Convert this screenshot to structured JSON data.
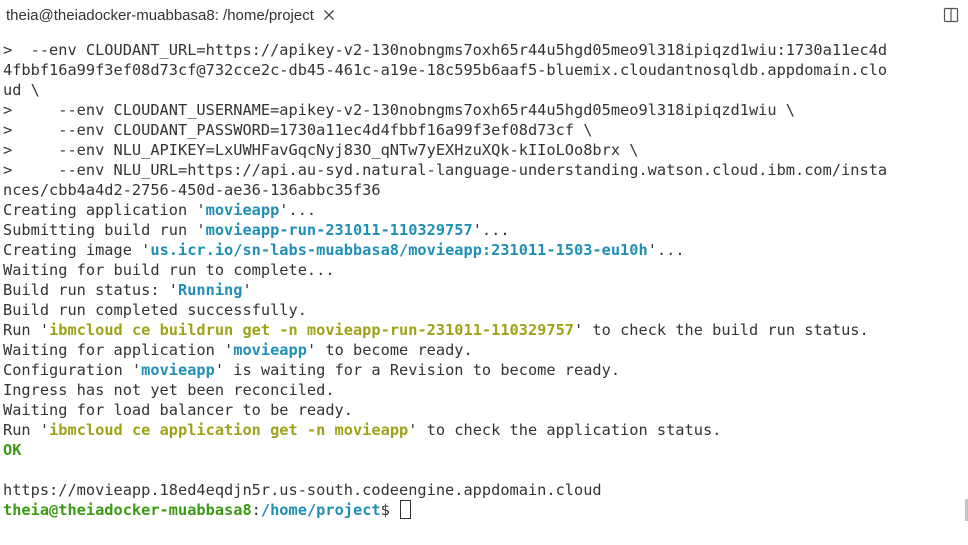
{
  "tab": {
    "title": "theia@theiadocker-muabbasa8: /home/project",
    "close_icon": "close-icon"
  },
  "toolbar": {
    "split_icon": "split-editor-icon"
  },
  "terminal": {
    "lines": [
      [
        {
          "t": ">  --env CLOUDANT_URL=https://apikey-v2-130nobngms7oxh65r44u5hgd05meo9l318ipiqzd1wiu:1730a11ec4d"
        }
      ],
      [
        {
          "t": "4fbbf16a99f3ef08d73cf@732cce2c-db45-461c-a19e-18c595b6aaf5-bluemix.cloudantnosqldb.appdomain.clo"
        }
      ],
      [
        {
          "t": "ud \\"
        }
      ],
      [
        {
          "t": ">     --env CLOUDANT_USERNAME=apikey-v2-130nobngms7oxh65r44u5hgd05meo9l318ipiqzd1wiu \\"
        }
      ],
      [
        {
          "t": ">     --env CLOUDANT_PASSWORD=1730a11ec4d4fbbf16a99f3ef08d73cf \\"
        }
      ],
      [
        {
          "t": ">     --env NLU_APIKEY=LxUWHFavGqcNyj83O_qNTw7yEXHzuXQk-kIIoLOo8brx \\"
        }
      ],
      [
        {
          "t": ">     --env NLU_URL=https://api.au-syd.natural-language-understanding.watson.cloud.ibm.com/insta"
        }
      ],
      [
        {
          "t": "nces/cbb4a4d2-2756-450d-ae36-136abbc35f36"
        }
      ],
      [
        {
          "t": "Creating application '"
        },
        {
          "t": "movieapp",
          "c": "cyan"
        },
        {
          "t": "'..."
        }
      ],
      [
        {
          "t": "Submitting build run '"
        },
        {
          "t": "movieapp-run-231011-110329757",
          "c": "cyan"
        },
        {
          "t": "'..."
        }
      ],
      [
        {
          "t": "Creating image '"
        },
        {
          "t": "us.icr.io/sn-labs-muabbasa8/movieapp:231011-1503-eu10h",
          "c": "cyan"
        },
        {
          "t": "'..."
        }
      ],
      [
        {
          "t": "Waiting for build run to complete..."
        }
      ],
      [
        {
          "t": "Build run status: '"
        },
        {
          "t": "Running",
          "c": "cyan"
        },
        {
          "t": "'"
        }
      ],
      [
        {
          "t": "Build run completed successfully."
        }
      ],
      [
        {
          "t": "Run '"
        },
        {
          "t": "ibmcloud ce buildrun get -n movieapp-run-231011-110329757",
          "c": "yellow"
        },
        {
          "t": "' to check the build run status."
        }
      ],
      [
        {
          "t": "Waiting for application '"
        },
        {
          "t": "movieapp",
          "c": "cyan"
        },
        {
          "t": "' to become ready."
        }
      ],
      [
        {
          "t": "Configuration '"
        },
        {
          "t": "movieapp",
          "c": "cyan"
        },
        {
          "t": "' is waiting for a Revision to become ready."
        }
      ],
      [
        {
          "t": "Ingress has not yet been reconciled."
        }
      ],
      [
        {
          "t": "Waiting for load balancer to be ready."
        }
      ],
      [
        {
          "t": "Run '"
        },
        {
          "t": "ibmcloud ce application get -n movieapp",
          "c": "yellow"
        },
        {
          "t": "' to check the application status."
        }
      ],
      [
        {
          "t": "OK",
          "c": "green"
        }
      ],
      [
        {
          "t": ""
        }
      ],
      [
        {
          "t": "https://movieapp.18ed4eqdjn5r.us-south.codeengine.appdomain.cloud"
        }
      ]
    ],
    "prompt": {
      "user_host": "theia@theiadocker-muabbasa8",
      "separator": ":",
      "path": "/home/project",
      "symbol": "$ "
    }
  }
}
